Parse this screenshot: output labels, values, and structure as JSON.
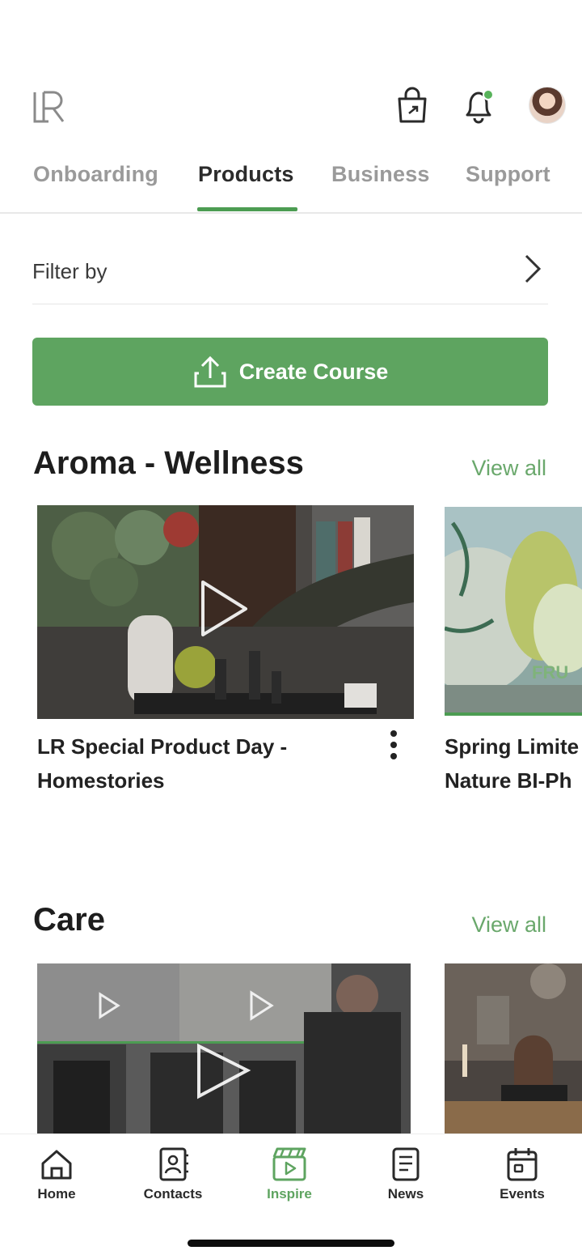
{
  "header": {
    "logo": "LR",
    "icons": [
      "shopping-bag-share-icon",
      "bell-icon",
      "avatar"
    ]
  },
  "tabs": [
    {
      "label": "Onboarding",
      "active": false
    },
    {
      "label": "Products",
      "active": true
    },
    {
      "label": "Business",
      "active": false
    },
    {
      "label": "Support",
      "active": false
    }
  ],
  "filter": {
    "label": "Filter by"
  },
  "create_course": {
    "label": "Create Course",
    "icon": "upload-icon"
  },
  "sections": [
    {
      "title": "Aroma - Wellness",
      "view_all": "View all",
      "cards": [
        {
          "title_line1": "LR Special Product Day -",
          "title_line2": "Homestories"
        },
        {
          "title_line1": "Spring Limite",
          "title_line2": "Nature BI-Ph",
          "image_text": "FRU"
        }
      ]
    },
    {
      "title": "Care",
      "view_all": "View all",
      "cards": [
        {},
        {}
      ]
    }
  ],
  "bottom_nav": [
    {
      "label": "Home",
      "icon": "home-icon",
      "active": false
    },
    {
      "label": "Contacts",
      "icon": "contacts-icon",
      "active": false
    },
    {
      "label": "Inspire",
      "icon": "clapperboard-icon",
      "active": true
    },
    {
      "label": "News",
      "icon": "news-icon",
      "active": false
    },
    {
      "label": "Events",
      "icon": "calendar-icon",
      "active": false
    }
  ],
  "colors": {
    "accent": "#5ea460",
    "inactive_tab": "#9a9a9a"
  }
}
